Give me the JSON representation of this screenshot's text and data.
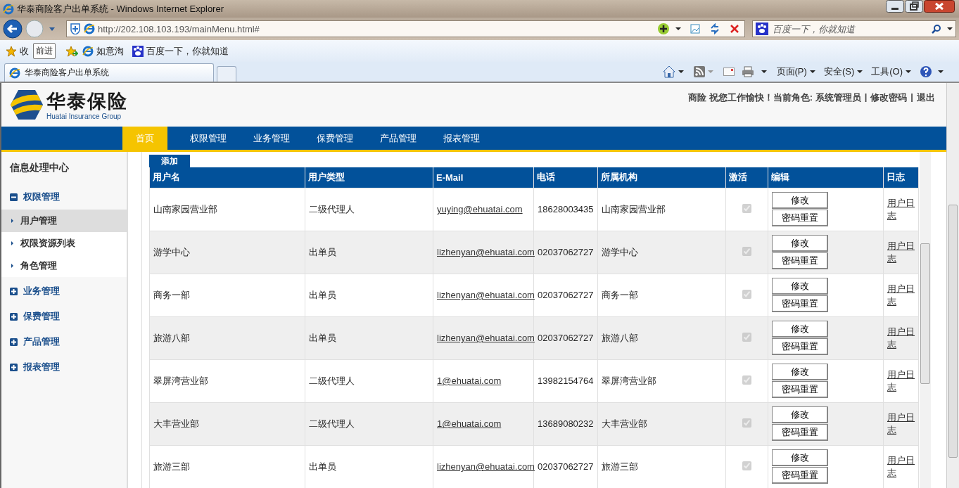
{
  "browser": {
    "title": "华泰商险客户出单系统 - Windows Internet Explorer",
    "url": "http://202.108.103.193/mainMenu.html#",
    "search_placeholder": "百度一下，你就知道",
    "favorites_label": "收",
    "tooltip": "前进",
    "favorite_links": [
      "如意淘",
      "百度一下，你就知道"
    ],
    "tabs": [
      {
        "label": "华泰商险客户出单系统",
        "selected": true
      }
    ],
    "menus": [
      "页面(P)",
      "安全(S)",
      "工具(O)"
    ]
  },
  "header": {
    "logo_name": "华泰保险",
    "logo_subtitle": "Huatai Insurance Group",
    "user_info": "商险 祝您工作愉快！当前角色: 系统管理员",
    "links": [
      {
        "label": "修改密码"
      },
      {
        "label": "退出"
      }
    ],
    "separators": [
      "|",
      "|"
    ]
  },
  "nav": [
    {
      "label": "首页",
      "selected": true
    },
    {
      "label": "权限管理",
      "selected": false
    },
    {
      "label": "业务管理",
      "selected": false
    },
    {
      "label": "保费管理",
      "selected": false
    },
    {
      "label": "产品管理",
      "selected": false
    },
    {
      "label": "报表管理",
      "selected": false
    }
  ],
  "sidebar": {
    "title": "信息处理中心",
    "groups": [
      {
        "label": "权限管理",
        "expanded": true,
        "children": [
          {
            "label": "用户管理",
            "selected": true
          },
          {
            "label": "权限资源列表",
            "selected": false
          },
          {
            "label": "角色管理",
            "selected": false
          }
        ]
      },
      {
        "label": "业务管理",
        "expanded": false
      },
      {
        "label": "保费管理",
        "expanded": false
      },
      {
        "label": "产品管理",
        "expanded": false
      },
      {
        "label": "报表管理",
        "expanded": false
      }
    ]
  },
  "table": {
    "add_button": "添加",
    "columns": [
      "用户名",
      "用户类型",
      "E-Mail",
      "电话",
      "所属机构",
      "激活",
      "编辑",
      "日志"
    ],
    "rows": [
      {
        "username": "山南家园营业部",
        "user_type": "二级代理人",
        "email": "yuying@ehuatai.com",
        "phone": "18628003435",
        "org": "山南家园营业部",
        "active": true,
        "actions": [
          "修改",
          "密码重置"
        ],
        "log": "用户日志"
      },
      {
        "username": "游学中心",
        "user_type": "出单员",
        "email": "lizhenyan@ehuatai.com",
        "phone": "02037062727",
        "org": "游学中心",
        "active": true,
        "actions": [
          "修改",
          "密码重置"
        ],
        "log": "用户日志"
      },
      {
        "username": "商务一部",
        "user_type": "出单员",
        "email": "lizhenyan@ehuatai.com",
        "phone": "02037062727",
        "org": "商务一部",
        "active": true,
        "actions": [
          "修改",
          "密码重置"
        ],
        "log": "用户日志"
      },
      {
        "username": "旅游八部",
        "user_type": "出单员",
        "email": "lizhenyan@ehuatai.com",
        "phone": "02037062727",
        "org": "旅游八部",
        "active": true,
        "actions": [
          "修改",
          "密码重置"
        ],
        "log": "用户日志"
      },
      {
        "username": "翠屏湾营业部",
        "user_type": "二级代理人",
        "email": "1@ehuatai.com",
        "phone": "13982154764",
        "org": "翠屏湾营业部",
        "active": true,
        "actions": [
          "修改",
          "密码重置"
        ],
        "log": "用户日志"
      },
      {
        "username": "大丰营业部",
        "user_type": "二级代理人",
        "email": "1@ehuatai.com",
        "phone": "13689080232",
        "org": "大丰营业部",
        "active": true,
        "actions": [
          "修改",
          "密码重置"
        ],
        "log": "用户日志"
      },
      {
        "username": "旅游三部",
        "user_type": "出单员",
        "email": "lizhenyan@ehuatai.com",
        "phone": "02037062727",
        "org": "旅游三部",
        "active": true,
        "actions": [
          "修改",
          "密码重置"
        ],
        "log": "用户日志"
      }
    ]
  }
}
